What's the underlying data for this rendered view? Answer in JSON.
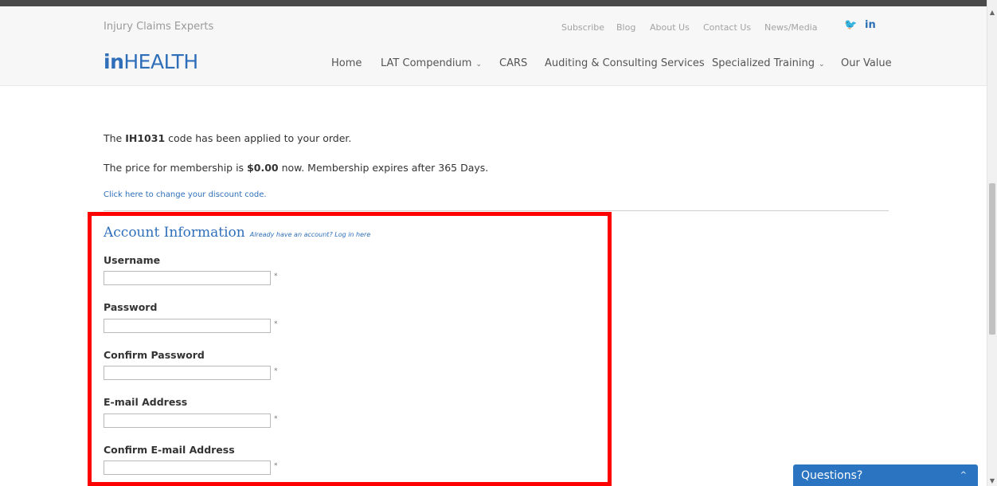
{
  "header": {
    "tagline": "Injury Claims Experts",
    "util_links": [
      "Subscribe",
      "Blog",
      "About Us",
      "Contact Us",
      "News/Media"
    ],
    "social": {
      "twitter_glyph": "🐦",
      "linkedin_glyph": "in"
    }
  },
  "nav": {
    "logo_bold": "in",
    "logo_rest": "HEALTH",
    "items": [
      {
        "label": "Home"
      },
      {
        "label": "LAT Compendium",
        "dropdown": true
      },
      {
        "label": "CARS"
      },
      {
        "label": "Auditing & Consulting Services"
      },
      {
        "label": "Specialized Training",
        "dropdown": true
      },
      {
        "label": "Our Value"
      }
    ],
    "chevron_glyph": "⌄"
  },
  "content": {
    "code_msg": {
      "pre": "The ",
      "code": "IH1031",
      "post": " code has been applied to your order."
    },
    "price_msg": {
      "pre": "The price for membership is ",
      "price": "$0.00",
      "post": " now. Membership expires after 365 Days."
    },
    "discount_link": "Click here to change your discount code."
  },
  "form": {
    "title": "Account Information",
    "login_link": "Already have an account? Log in here",
    "required_mark": "*",
    "fields": [
      {
        "label": "Username",
        "value": ""
      },
      {
        "label": "Password",
        "value": ""
      },
      {
        "label": "Confirm Password",
        "value": ""
      },
      {
        "label": "E-mail Address",
        "value": ""
      },
      {
        "label": "Confirm E-mail Address",
        "value": ""
      }
    ]
  },
  "widget": {
    "label": "Questions?",
    "chevron_glyph": "^"
  },
  "colors": {
    "brand_blue": "#2f6fba",
    "highlight_red": "#ff0000",
    "widget_blue": "#2a74c2"
  }
}
